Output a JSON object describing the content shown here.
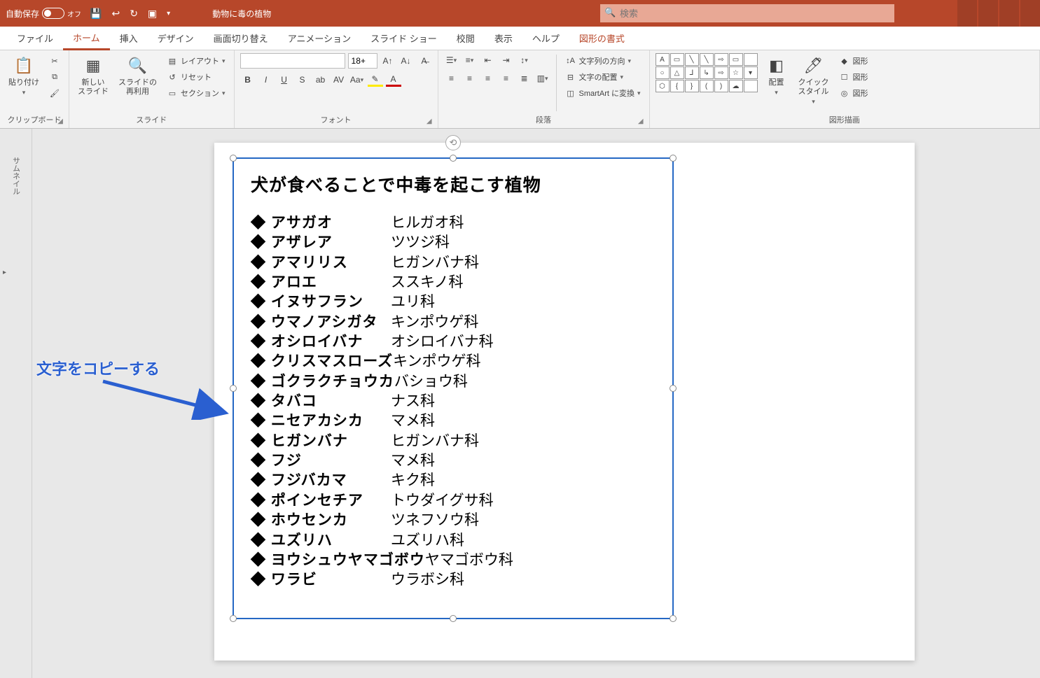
{
  "titleBar": {
    "autosaveLabel": "自動保存",
    "autosaveState": "オフ",
    "docTitle": "動物に毒の植物",
    "searchPlaceholder": "検索"
  },
  "tabs": {
    "file": "ファイル",
    "home": "ホーム",
    "insert": "挿入",
    "design": "デザイン",
    "transitions": "画面切り替え",
    "animations": "アニメーション",
    "slideshow": "スライド ショー",
    "review": "校閲",
    "view": "表示",
    "help": "ヘルプ",
    "shapeFormat": "図形の書式"
  },
  "ribbon": {
    "clipboard": {
      "paste": "貼り付け",
      "label": "クリップボード"
    },
    "slides": {
      "newSlide": "新しい\nスライド",
      "reuse": "スライドの\n再利用",
      "layout": "レイアウト",
      "reset": "リセット",
      "section": "セクション",
      "label": "スライド"
    },
    "font": {
      "size": "18+",
      "label": "フォント"
    },
    "paragraph": {
      "textDir": "文字列の方向",
      "align": "文字の配置",
      "smartart": "SmartArt に変換",
      "label": "段落"
    },
    "drawing": {
      "arrange": "配置",
      "quickStyle": "クイック\nスタイル",
      "shapeFill": "図形",
      "shapeOutline": "図形",
      "shapeEffects": "図形",
      "label": "図形描画"
    }
  },
  "thumbRail": {
    "label": "サムネイル"
  },
  "textBox": {
    "title": "犬が食べることで中毒を起こす植物",
    "items": [
      {
        "name": "アサガオ",
        "family": "ヒルガオ科"
      },
      {
        "name": "アザレア",
        "family": "ツツジ科"
      },
      {
        "name": "アマリリス",
        "family": "ヒガンバナ科"
      },
      {
        "name": "アロエ",
        "family": "ススキノ科"
      },
      {
        "name": "イヌサフラン",
        "family": "ユリ科"
      },
      {
        "name": "ウマノアシガタ",
        "family": "キンポウゲ科"
      },
      {
        "name": "オシロイバナ",
        "family": "オシロイバナ科"
      },
      {
        "name": "クリスマスローズ",
        "family": "キンポウゲ科"
      },
      {
        "name": "ゴクラクチョウカ",
        "family": "バショウ科"
      },
      {
        "name": "タバコ",
        "family": "ナス科"
      },
      {
        "name": "ニセアカシカ",
        "family": "マメ科"
      },
      {
        "name": "ヒガンバナ",
        "family": "ヒガンバナ科"
      },
      {
        "name": "フジ",
        "family": "マメ科"
      },
      {
        "name": "フジバカマ",
        "family": "キク科"
      },
      {
        "name": "ポインセチア",
        "family": "トウダイグサ科"
      },
      {
        "name": "ホウセンカ",
        "family": "ツネフソウ科"
      },
      {
        "name": "ユズリハ",
        "family": "ユズリハ科"
      },
      {
        "name": "ヨウシュウヤマゴボウ",
        "family": "ヤマゴボウ科"
      },
      {
        "name": "ワラビ",
        "family": "ウラボシ科"
      }
    ]
  },
  "annotation": {
    "text": "文字をコピーする"
  }
}
